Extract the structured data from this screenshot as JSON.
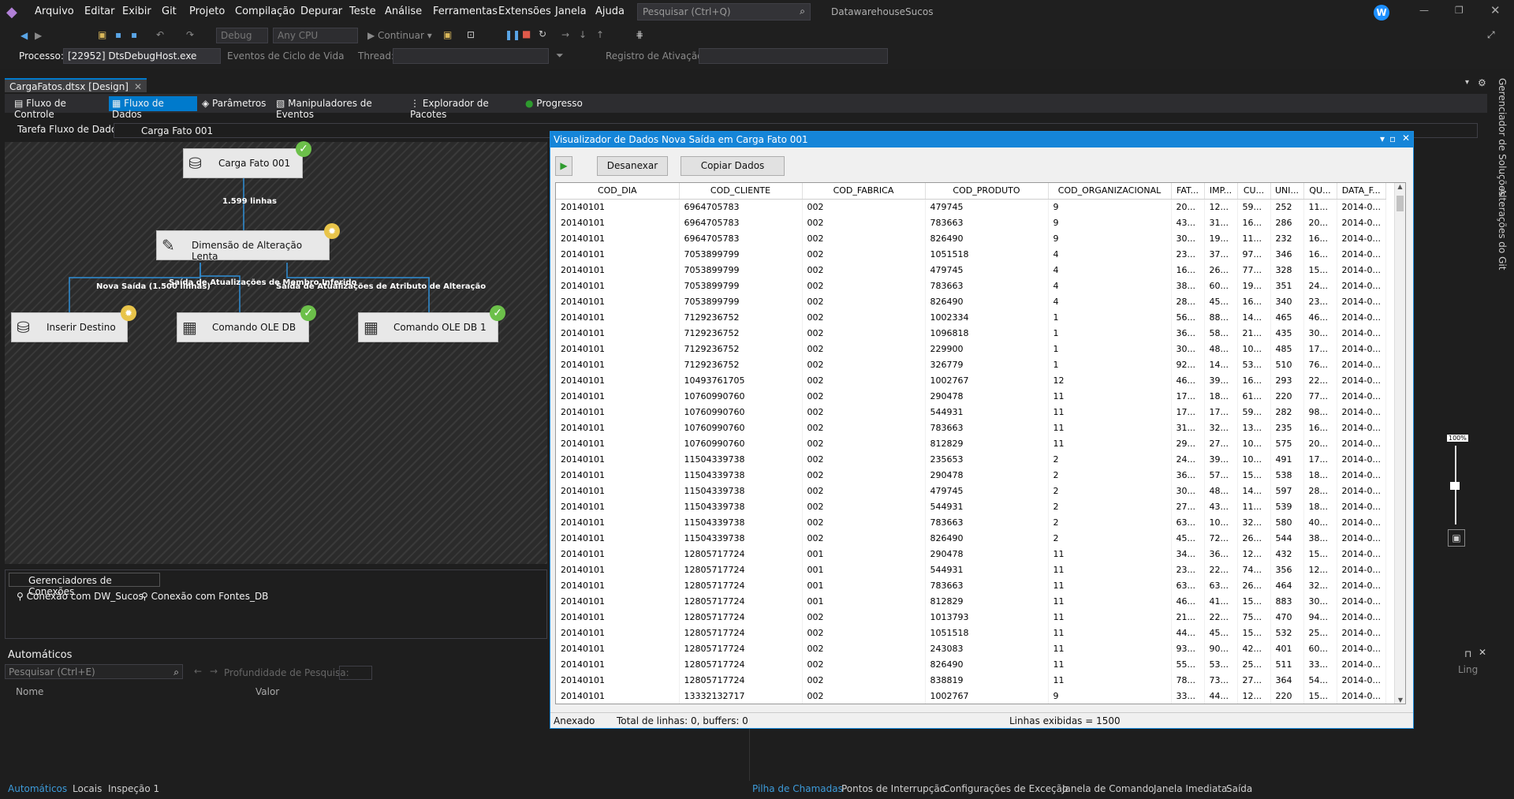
{
  "menu": {
    "items": [
      "Arquivo",
      "Editar",
      "Exibir",
      "Git",
      "Projeto",
      "Compilação",
      "Depurar",
      "Teste",
      "Análise",
      "Ferramentas",
      "Extensões",
      "Janela",
      "Ajuda"
    ],
    "search_placeholder": "Pesquisar (Ctrl+Q)",
    "solution_name": "DatawarehouseSucos",
    "avatar": "W"
  },
  "toolbar": {
    "config": "Debug",
    "platform": "Any CPU",
    "continue_label": "Continuar",
    "process_label": "Processo:",
    "process_value": "[22952] DtsDebugHost.exe",
    "lifecycle_label": "Eventos de Ciclo de Vida",
    "thread_label": "Thread:",
    "activation_label": "Registro de Ativação:"
  },
  "doc_tab": "CargaFatos.dtsx [Design]",
  "designer_tabs": [
    "Fluxo de Controle",
    "Fluxo de Dados",
    "Parâmetros",
    "Manipuladores de Eventos",
    "Explorador de Pacotes",
    "Progresso"
  ],
  "task": {
    "label": "Tarefa Fluxo de Dados:",
    "value": "Carga Fato 001"
  },
  "nodes": {
    "source": "Carga Fato 001",
    "scd": "Dimensão de Alteração Lenta",
    "insert": "Inserir Destino",
    "ole1": "Comando OLE DB",
    "ole2": "Comando OLE DB 1"
  },
  "flows": {
    "rows_source": "1.599 linhas",
    "new_output": "Nova Saída (1.500 linhas)",
    "inferred": "Saída de Atualizações de Membro Inferido",
    "changing": "Saída de Atualizações de Atributo de Alteração"
  },
  "connections": {
    "tab": "Gerenciadores de Conexões",
    "items": [
      "Conexão com DW_Sucos",
      "Conexão com Fontes_DB"
    ]
  },
  "autos": {
    "title": "Automáticos",
    "search_placeholder": "Pesquisar (Ctrl+E)",
    "depth_label": "Profundidade de Pesquisa:",
    "col_name": "Nome",
    "col_value": "Valor",
    "lang": "Ling"
  },
  "bottom_left_tabs": [
    "Automáticos",
    "Locais",
    "Inspeção 1"
  ],
  "bottom_right_tabs": [
    "Pilha de Chamadas",
    "Pontos de Interrupção",
    "Configurações de Exceção",
    "Janela de Comando",
    "Janela Imediata",
    "Saída"
  ],
  "right_rail": [
    "Gerenciador de Soluções",
    "Alterações do Git"
  ],
  "zoom": "100%",
  "viewer": {
    "title": "Visualizador de Dados Nova Saída em Carga Fato 001",
    "btn_detach": "Desanexar",
    "btn_copy": "Copiar Dados",
    "status_attached": "Anexado",
    "status_total": "Total de linhas: 0, buffers: 0",
    "status_shown": "Linhas exibidas = 1500",
    "columns": [
      "COD_DIA",
      "COD_CLIENTE",
      "COD_FABRICA",
      "COD_PRODUTO",
      "COD_ORGANIZACIONAL",
      "FAT...",
      "IMP...",
      "CU...",
      "UNI...",
      "QU...",
      "DATA_F..."
    ],
    "rows": [
      [
        "20140101",
        "6964705783",
        "002",
        "479745",
        "9",
        "20...",
        "12...",
        "59...",
        "252",
        "11...",
        "2014-0..."
      ],
      [
        "20140101",
        "6964705783",
        "002",
        "783663",
        "9",
        "43...",
        "31...",
        "16...",
        "286",
        "20...",
        "2014-0..."
      ],
      [
        "20140101",
        "6964705783",
        "002",
        "826490",
        "9",
        "30...",
        "19...",
        "11...",
        "232",
        "16...",
        "2014-0..."
      ],
      [
        "20140101",
        "7053899799",
        "002",
        "1051518",
        "4",
        "23...",
        "37...",
        "97...",
        "346",
        "16...",
        "2014-0..."
      ],
      [
        "20140101",
        "7053899799",
        "002",
        "479745",
        "4",
        "16...",
        "26...",
        "77...",
        "328",
        "15...",
        "2014-0..."
      ],
      [
        "20140101",
        "7053899799",
        "002",
        "783663",
        "4",
        "38...",
        "60...",
        "19...",
        "351",
        "24...",
        "2014-0..."
      ],
      [
        "20140101",
        "7053899799",
        "002",
        "826490",
        "4",
        "28...",
        "45...",
        "16...",
        "340",
        "23...",
        "2014-0..."
      ],
      [
        "20140101",
        "7129236752",
        "002",
        "1002334",
        "1",
        "56...",
        "88...",
        "14...",
        "465",
        "46...",
        "2014-0..."
      ],
      [
        "20140101",
        "7129236752",
        "002",
        "1096818",
        "1",
        "36...",
        "58...",
        "21...",
        "435",
        "30...",
        "2014-0..."
      ],
      [
        "20140101",
        "7129236752",
        "002",
        "229900",
        "1",
        "30...",
        "48...",
        "10...",
        "485",
        "17...",
        "2014-0..."
      ],
      [
        "20140101",
        "7129236752",
        "002",
        "326779",
        "1",
        "92...",
        "14...",
        "53...",
        "510",
        "76...",
        "2014-0..."
      ],
      [
        "20140101",
        "10493761705",
        "002",
        "1002767",
        "12",
        "46...",
        "39...",
        "16...",
        "293",
        "22...",
        "2014-0..."
      ],
      [
        "20140101",
        "10760990760",
        "002",
        "290478",
        "11",
        "17...",
        "18...",
        "61...",
        "220",
        "77...",
        "2014-0..."
      ],
      [
        "20140101",
        "10760990760",
        "002",
        "544931",
        "11",
        "17...",
        "17...",
        "59...",
        "282",
        "98...",
        "2014-0..."
      ],
      [
        "20140101",
        "10760990760",
        "002",
        "783663",
        "11",
        "31...",
        "32...",
        "13...",
        "235",
        "16...",
        "2014-0..."
      ],
      [
        "20140101",
        "10760990760",
        "002",
        "812829",
        "11",
        "29...",
        "27...",
        "10...",
        "575",
        "20...",
        "2014-0..."
      ],
      [
        "20140101",
        "11504339738",
        "002",
        "235653",
        "2",
        "24...",
        "39...",
        "10...",
        "491",
        "17...",
        "2014-0..."
      ],
      [
        "20140101",
        "11504339738",
        "002",
        "290478",
        "2",
        "36...",
        "57...",
        "15...",
        "538",
        "18...",
        "2014-0..."
      ],
      [
        "20140101",
        "11504339738",
        "002",
        "479745",
        "2",
        "30...",
        "48...",
        "14...",
        "597",
        "28...",
        "2014-0..."
      ],
      [
        "20140101",
        "11504339738",
        "002",
        "544931",
        "2",
        "27...",
        "43...",
        "11...",
        "539",
        "18...",
        "2014-0..."
      ],
      [
        "20140101",
        "11504339738",
        "002",
        "783663",
        "2",
        "63...",
        "10...",
        "32...",
        "580",
        "40...",
        "2014-0..."
      ],
      [
        "20140101",
        "11504339738",
        "002",
        "826490",
        "2",
        "45...",
        "72...",
        "26...",
        "544",
        "38...",
        "2014-0..."
      ],
      [
        "20140101",
        "12805717724",
        "001",
        "290478",
        "11",
        "34...",
        "36...",
        "12...",
        "432",
        "15...",
        "2014-0..."
      ],
      [
        "20140101",
        "12805717724",
        "001",
        "544931",
        "11",
        "23...",
        "22...",
        "74...",
        "356",
        "12...",
        "2014-0..."
      ],
      [
        "20140101",
        "12805717724",
        "001",
        "783663",
        "11",
        "63...",
        "63...",
        "26...",
        "464",
        "32...",
        "2014-0..."
      ],
      [
        "20140101",
        "12805717724",
        "001",
        "812829",
        "11",
        "46...",
        "41...",
        "15...",
        "883",
        "30...",
        "2014-0..."
      ],
      [
        "20140101",
        "12805717724",
        "002",
        "1013793",
        "11",
        "21...",
        "22...",
        "75...",
        "470",
        "94...",
        "2014-0..."
      ],
      [
        "20140101",
        "12805717724",
        "002",
        "1051518",
        "11",
        "44...",
        "45...",
        "15...",
        "532",
        "25...",
        "2014-0..."
      ],
      [
        "20140101",
        "12805717724",
        "002",
        "243083",
        "11",
        "93...",
        "90...",
        "42...",
        "401",
        "60...",
        "2014-0..."
      ],
      [
        "20140101",
        "12805717724",
        "002",
        "826490",
        "11",
        "55...",
        "53...",
        "25...",
        "511",
        "33...",
        "2014-0..."
      ],
      [
        "20140101",
        "12805717724",
        "002",
        "838819",
        "11",
        "78...",
        "73...",
        "27...",
        "364",
        "54...",
        "2014-0..."
      ],
      [
        "20140101",
        "13332132717",
        "002",
        "1002767",
        "9",
        "33...",
        "44...",
        "12...",
        "220",
        "15...",
        "2014-0..."
      ]
    ]
  }
}
